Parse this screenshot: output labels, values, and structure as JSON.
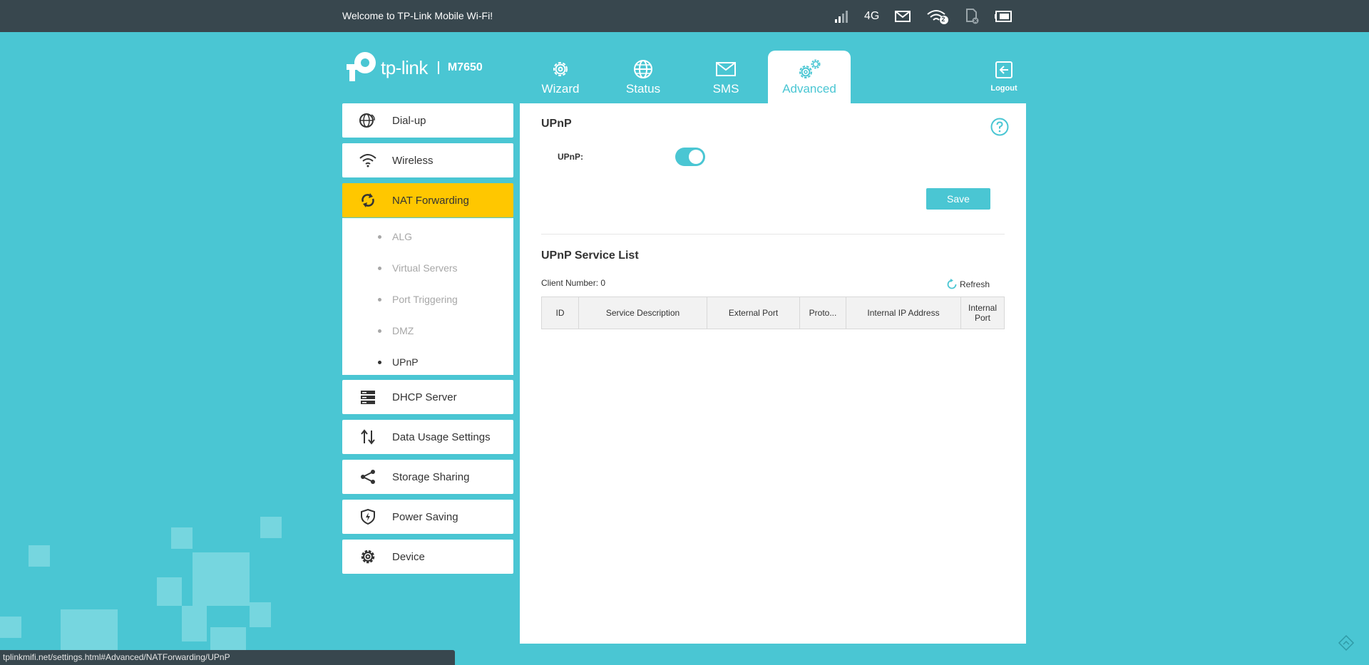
{
  "topbar": {
    "welcome": "Welcome to TP-Link Mobile Wi-Fi!",
    "network_type": "4G",
    "wifi_clients": "2"
  },
  "header": {
    "brand": "tp-link",
    "model": "M7650",
    "tabs": [
      {
        "label": "Wizard",
        "icon": "gear-icon"
      },
      {
        "label": "Status",
        "icon": "globe-icon"
      },
      {
        "label": "SMS",
        "icon": "envelope-icon"
      },
      {
        "label": "Advanced",
        "icon": "gears-icon",
        "active": true
      }
    ],
    "logout_label": "Logout"
  },
  "sidebar": {
    "items": [
      {
        "label": "Dial-up",
        "icon": "dialup-globe-icon"
      },
      {
        "label": "Wireless",
        "icon": "wifi-icon"
      },
      {
        "label": "NAT Forwarding",
        "icon": "nat-forwarding-icon",
        "active": true
      },
      {
        "label": "DHCP Server",
        "icon": "server-icon"
      },
      {
        "label": "Data Usage Settings",
        "icon": "data-usage-icon"
      },
      {
        "label": "Storage Sharing",
        "icon": "share-icon"
      },
      {
        "label": "Power Saving",
        "icon": "shield-icon"
      },
      {
        "label": "Device",
        "icon": "gear-icon"
      }
    ],
    "submenu": [
      {
        "label": "ALG"
      },
      {
        "label": "Virtual Servers"
      },
      {
        "label": "Port Triggering"
      },
      {
        "label": "DMZ"
      },
      {
        "label": "UPnP",
        "active": true
      }
    ]
  },
  "main": {
    "section_title": "UPnP",
    "upnp_label": "UPnP:",
    "upnp_enabled": true,
    "save_label": "Save",
    "service_list_title": "UPnP Service List",
    "client_number": "Client Number: 0",
    "refresh_label": "Refresh",
    "table_headers": [
      "ID",
      "Service Description",
      "External Port",
      "Proto...",
      "Internal IP Address",
      "Internal Port"
    ]
  },
  "statusbar": {
    "url": "tplinkmifi.net/settings.html#Advanced/NATForwarding/UPnP"
  },
  "colors": {
    "accent": "#4ac6d3",
    "active_menu": "#ffc700",
    "topbar": "#38474e"
  }
}
